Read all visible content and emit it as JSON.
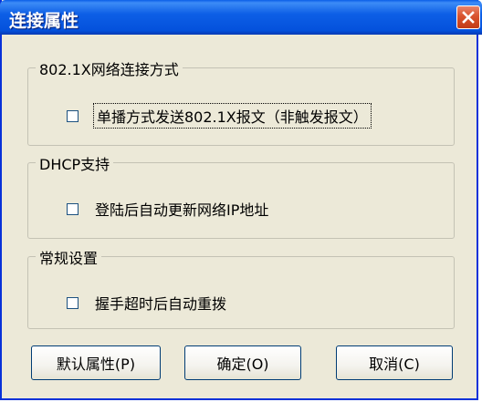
{
  "window": {
    "title": "连接属性"
  },
  "groups": [
    {
      "legend": "802.1X网络连接方式",
      "checkbox_label": "单播方式发送802.1X报文（非触发报文）",
      "checked": false
    },
    {
      "legend": "DHCP支持",
      "checkbox_label": "登陆后自动更新网络IP地址",
      "checked": false
    },
    {
      "legend": "常规设置",
      "checkbox_label": "握手超时后自动重拨",
      "checked": false
    }
  ],
  "buttons": {
    "default_props": "默认属性(P)",
    "ok": "确定(O)",
    "cancel": "取消(C)"
  },
  "colors": {
    "titlebar": "#0451dc",
    "dialog_bg": "#ece9d8",
    "close_button": "#d9532e"
  }
}
